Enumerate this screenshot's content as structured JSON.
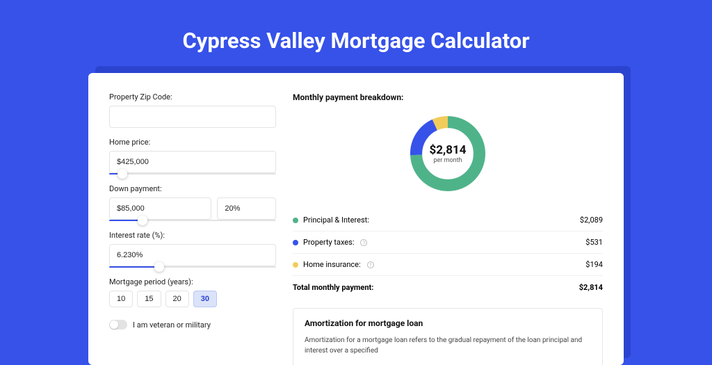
{
  "title": "Cypress Valley Mortgage Calculator",
  "form": {
    "zip": {
      "label": "Property Zip Code:",
      "value": ""
    },
    "price": {
      "label": "Home price:",
      "value": "$425,000",
      "slider_percent": 8
    },
    "down": {
      "label": "Down payment:",
      "value": "$85,000",
      "percent": "20%",
      "slider_percent": 20
    },
    "rate": {
      "label": "Interest rate (%):",
      "value": "6.230%",
      "slider_percent": 30
    },
    "period": {
      "label": "Mortgage period (years):",
      "options": [
        "10",
        "15",
        "20",
        "30"
      ],
      "selected": "30"
    },
    "veteran": {
      "label": "I am veteran or military"
    }
  },
  "breakdown": {
    "title": "Monthly payment breakdown:",
    "center_amount": "$2,814",
    "center_sub": "per month",
    "items": [
      {
        "label": "Principal & Interest:",
        "value": "$2,089",
        "color": "#4fb38a",
        "info": false
      },
      {
        "label": "Property taxes:",
        "value": "$531",
        "color": "#3652e9",
        "info": true
      },
      {
        "label": "Home insurance:",
        "value": "$194",
        "color": "#f2cc5b",
        "info": true
      }
    ],
    "total_label": "Total monthly payment:",
    "total_value": "$2,814"
  },
  "amortization": {
    "title": "Amortization for mortgage loan",
    "text": "Amortization for a mortgage loan refers to the gradual repayment of the loan principal and interest over a specified"
  },
  "chart_data": {
    "type": "pie",
    "title": "Monthly payment breakdown",
    "series": [
      {
        "name": "Principal & Interest",
        "value": 2089,
        "color": "#4fb38a"
      },
      {
        "name": "Property taxes",
        "value": 531,
        "color": "#3652e9"
      },
      {
        "name": "Home insurance",
        "value": 194,
        "color": "#f2cc5b"
      }
    ],
    "total": 2814,
    "center_label": "$2,814 per month"
  }
}
